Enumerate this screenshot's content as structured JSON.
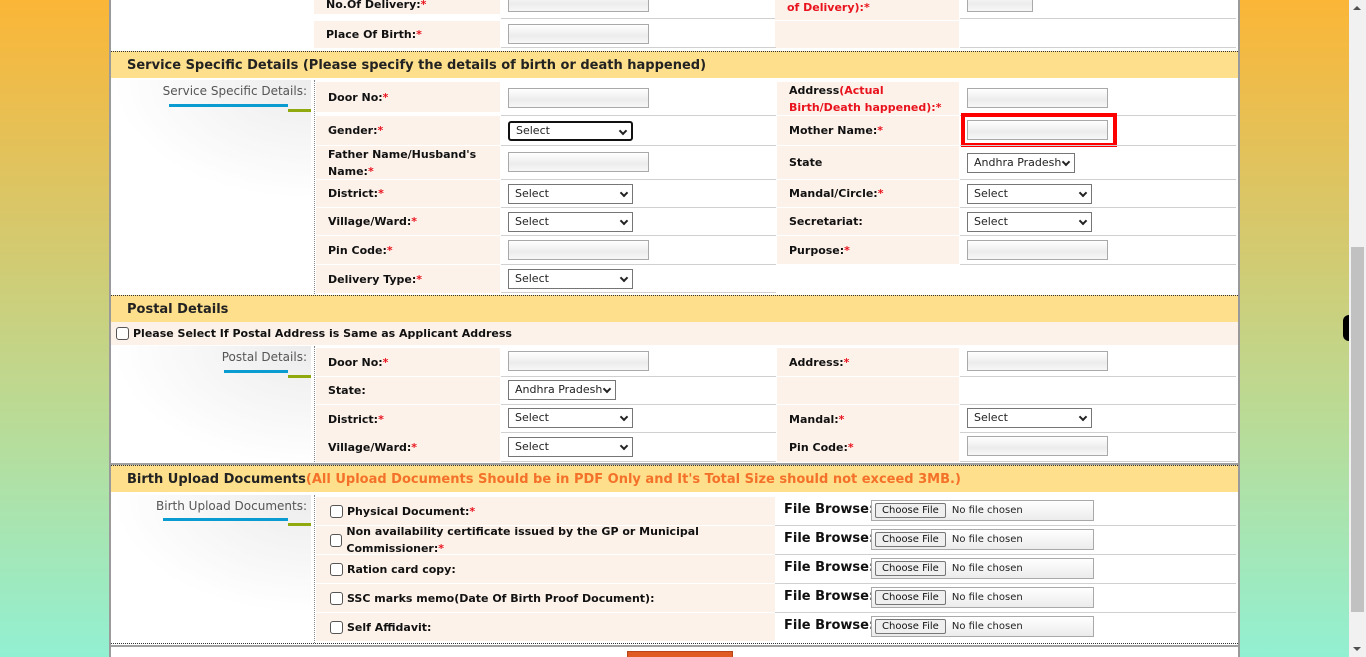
{
  "top_rows": {
    "no_of_delivery": {
      "label": "No.Of Delivery:",
      "required": "*"
    },
    "place_of_birth": {
      "label": "Place Of Birth:",
      "required": "*"
    },
    "right_partial_label": "of Delivery):",
    "right_partial_required": "*"
  },
  "service_section": {
    "title": "Service Specific Details (Please specify the details of birth or death happened)",
    "group_label": "Service Specific Details:",
    "left_fields": [
      {
        "label": "Door No:",
        "required": "*",
        "type": "text",
        "value": ""
      },
      {
        "label": "Gender:",
        "required": "*",
        "type": "select",
        "value": "Select"
      },
      {
        "label": "Father Name/Husband's Name:",
        "required": "*",
        "type": "text",
        "value": ""
      },
      {
        "label": "District:",
        "required": "*",
        "type": "select",
        "value": "Select"
      },
      {
        "label": "Village/Ward:",
        "required": "*",
        "type": "select",
        "value": "Select"
      },
      {
        "label": "Pin Code:",
        "required": "*",
        "type": "text",
        "value": ""
      },
      {
        "label": "Delivery Type:",
        "required": "*",
        "type": "select",
        "value": "Select"
      }
    ],
    "right_fields": [
      {
        "label": "Address",
        "label_note": "(Actual Birth/Death happened):",
        "required": "*",
        "type": "text",
        "value": ""
      },
      {
        "label": "Mother Name:",
        "required": "*",
        "type": "text",
        "value": "",
        "highlighted": true
      },
      {
        "label": "State",
        "required": "",
        "type": "select",
        "value": "Andhra Pradesh"
      },
      {
        "label": "Mandal/Circle:",
        "required": "*",
        "type": "select",
        "value": "Select"
      },
      {
        "label": "Secretariat:",
        "required": "",
        "type": "select",
        "value": "Select"
      },
      {
        "label": "Purpose:",
        "required": "*",
        "type": "text",
        "value": ""
      }
    ]
  },
  "postal_section": {
    "title": "Postal Details",
    "same_address_checkbox": {
      "label": "Please Select If Postal Address is Same as Applicant Address",
      "checked": false
    },
    "group_label": "Postal Details:",
    "left_fields": [
      {
        "label": "Door No:",
        "required": "*",
        "type": "text",
        "value": ""
      },
      {
        "label": "State:",
        "required": "",
        "type": "select",
        "value": "Andhra Pradesh"
      },
      {
        "label": "District:",
        "required": "*",
        "type": "select",
        "value": "Select"
      },
      {
        "label": "Village/Ward:",
        "required": "*",
        "type": "select",
        "value": "Select"
      }
    ],
    "right_fields": [
      {
        "label": "Address:",
        "required": "*",
        "type": "text",
        "value": ""
      },
      {
        "label": "",
        "required": "",
        "type": "empty"
      },
      {
        "label": "Mandal:",
        "required": "*",
        "type": "select",
        "value": "Select"
      },
      {
        "label": "Pin Code:",
        "required": "*",
        "type": "text",
        "value": ""
      }
    ]
  },
  "upload_section": {
    "title": "Birth Upload Documents",
    "title_note": "(All Upload Documents Should be in PDF Only and It's Total Size should not exceed 3MB.)",
    "group_label": "Birth Upload Documents:",
    "file_browse_label": "File Browse:",
    "choose_file_label": "Choose File",
    "no_file_label": "No file chosen",
    "documents": [
      {
        "label": "Physical Document:",
        "required": "*",
        "checked": false
      },
      {
        "label": "Non availability certificate issued by the GP or Municipal Commissioner:",
        "required": "*",
        "checked": false
      },
      {
        "label": "Ration card copy:",
        "required": "",
        "checked": false
      },
      {
        "label": "SSC marks memo(Date Of Birth Proof Document):",
        "required": "",
        "checked": false
      },
      {
        "label": "Self Affidavit:",
        "required": "",
        "checked": false
      }
    ]
  },
  "colors": {
    "section_header_bg": "#fedf8b",
    "label_bg": "#fdf2ea",
    "required": "#e8131d",
    "note_orange": "#f4712a",
    "highlight": "#ff0000",
    "accent_blue": "#0a9bd0",
    "accent_green": "#8fa90f",
    "submit_button": "#e05a24"
  }
}
